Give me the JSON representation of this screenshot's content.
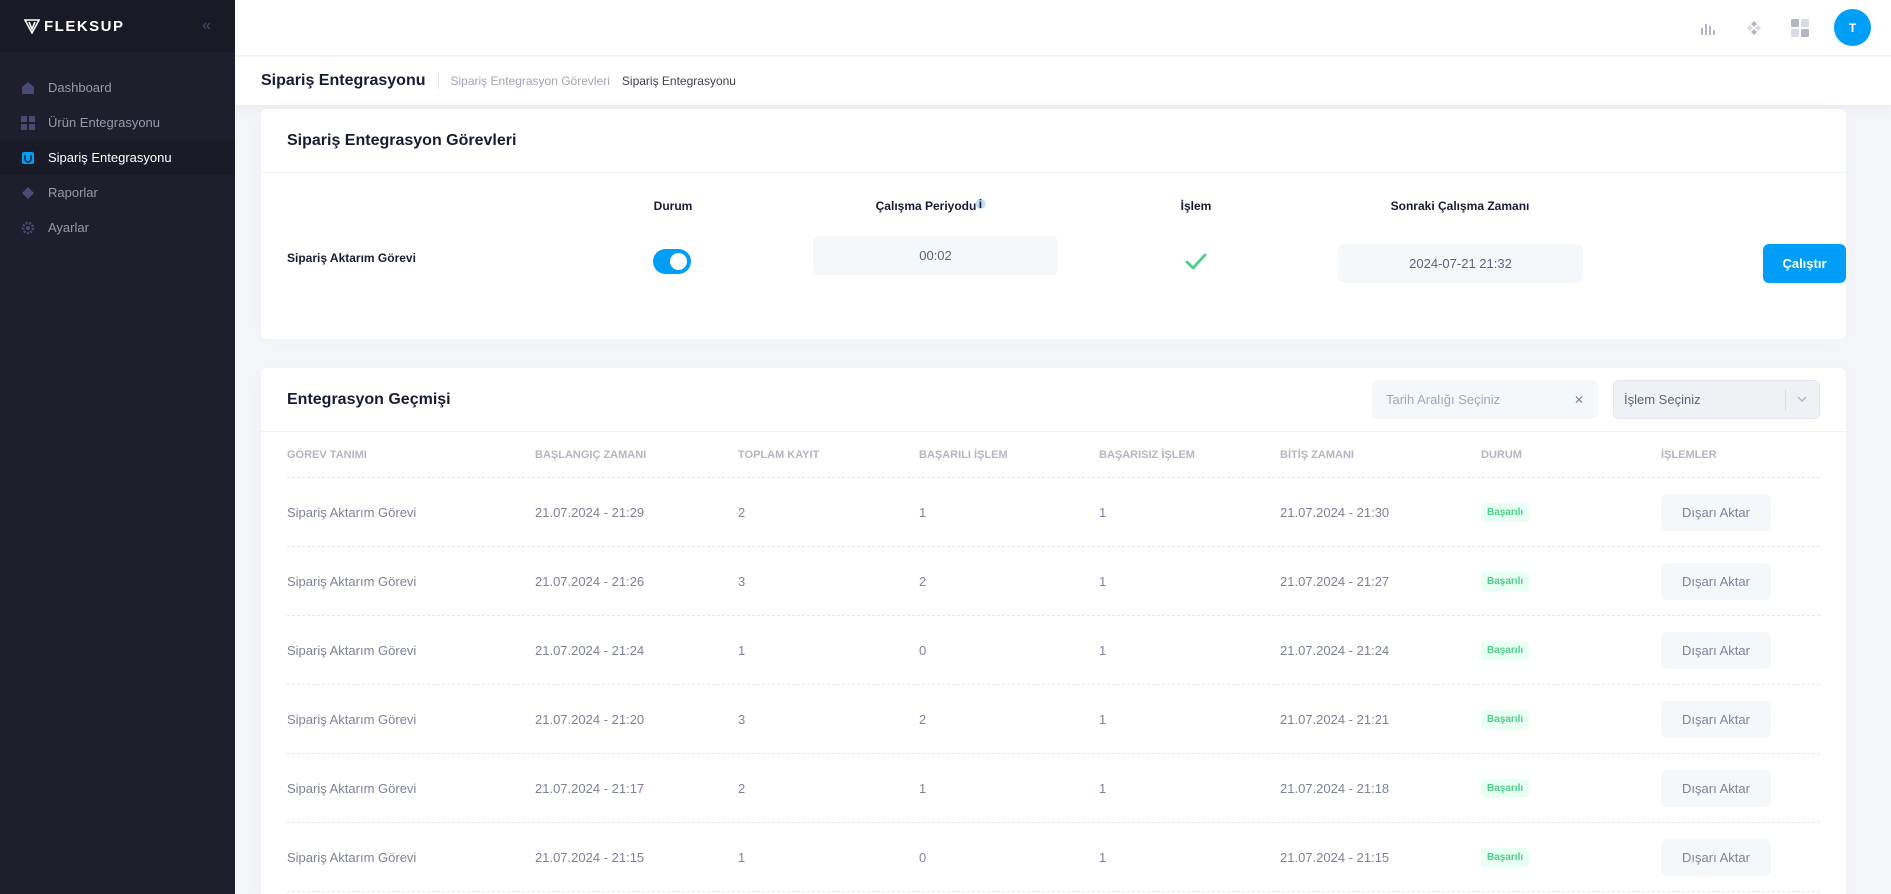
{
  "brand": {
    "name": "FLEKSUP"
  },
  "sidebar": {
    "items": [
      {
        "label": "Dashboard",
        "icon": "home-icon",
        "active": false
      },
      {
        "label": "Ürün Entegrasyonu",
        "icon": "grid-icon",
        "active": false
      },
      {
        "label": "Sipariş Entegrasyonu",
        "icon": "cart-icon",
        "active": true
      },
      {
        "label": "Raporlar",
        "icon": "chart-icon",
        "active": false
      },
      {
        "label": "Ayarlar",
        "icon": "gear-icon",
        "active": false
      }
    ]
  },
  "header": {
    "avatar_initial": "T"
  },
  "toolbar": {
    "page_title": "Sipariş Entegrasyonu",
    "breadcrumb": [
      "Sipariş Entegrasyon Görevleri",
      "Sipariş Entegrasyonu"
    ]
  },
  "tasks_card": {
    "title": "Sipariş Entegrasyon Görevleri",
    "columns": {
      "status": "Durum",
      "period": "Çalışma Periyodu",
      "operation": "İşlem",
      "next_run": "Sonraki Çalışma Zamanı"
    },
    "task": {
      "name": "Sipariş Aktarım Görevi",
      "enabled": true,
      "period": "00:02",
      "next_run": "2024-07-21 21:32",
      "run_label": "Çalıştır"
    }
  },
  "history_card": {
    "title": "Entegrasyon Geçmişi",
    "date_placeholder": "Tarih Aralığı Seçiniz",
    "operation_placeholder": "İşlem Seçiniz",
    "columns": [
      "GÖREV TANIMI",
      "BAŞLANGIÇ ZAMANI",
      "TOPLAM KAYIT",
      "BAŞARILI İŞLEM",
      "BAŞARISIZ İŞLEM",
      "BİTİŞ ZAMANI",
      "DURUM",
      "İŞLEMLER"
    ],
    "rows": [
      {
        "task": "Sipariş Aktarım Görevi",
        "start": "21.07.2024 - 21:29",
        "total": "2",
        "success": "1",
        "fail": "1",
        "end": "21.07.2024 - 21:30",
        "status": "Başarılı",
        "action": "Dışarı Aktar"
      },
      {
        "task": "Sipariş Aktarım Görevi",
        "start": "21.07.2024 - 21:26",
        "total": "3",
        "success": "2",
        "fail": "1",
        "end": "21.07.2024 - 21:27",
        "status": "Başarılı",
        "action": "Dışarı Aktar"
      },
      {
        "task": "Sipariş Aktarım Görevi",
        "start": "21.07.2024 - 21:24",
        "total": "1",
        "success": "0",
        "fail": "1",
        "end": "21.07.2024 - 21:24",
        "status": "Başarılı",
        "action": "Dışarı Aktar"
      },
      {
        "task": "Sipariş Aktarım Görevi",
        "start": "21.07.2024 - 21:20",
        "total": "3",
        "success": "2",
        "fail": "1",
        "end": "21.07.2024 - 21:21",
        "status": "Başarılı",
        "action": "Dışarı Aktar"
      },
      {
        "task": "Sipariş Aktarım Görevi",
        "start": "21.07.2024 - 21:17",
        "total": "2",
        "success": "1",
        "fail": "1",
        "end": "21.07.2024 - 21:18",
        "status": "Başarılı",
        "action": "Dışarı Aktar"
      },
      {
        "task": "Sipariş Aktarım Görevi",
        "start": "21.07.2024 - 21:15",
        "total": "1",
        "success": "0",
        "fail": "1",
        "end": "21.07.2024 - 21:15",
        "status": "Başarılı",
        "action": "Dışarı Aktar"
      }
    ]
  },
  "colors": {
    "primary": "#009ef7",
    "sidebar_bg": "#1e1e2d",
    "success": "#50cd89"
  }
}
